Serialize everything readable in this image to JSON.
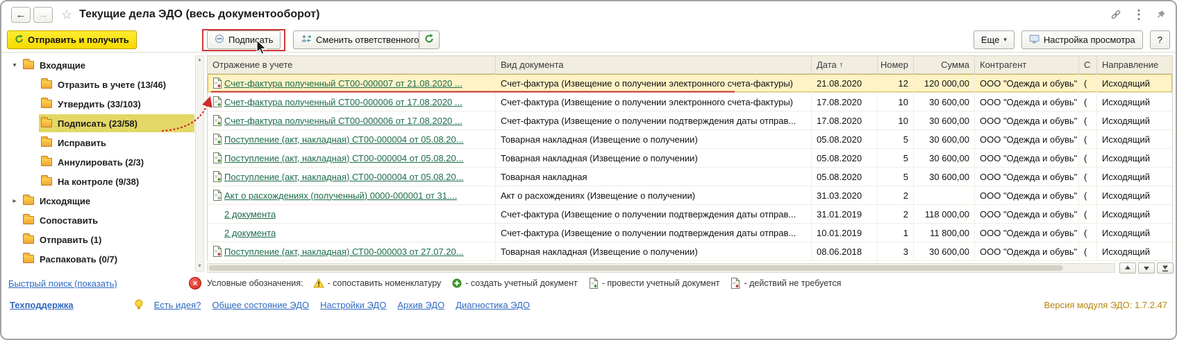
{
  "window": {
    "title": "Текущие дела ЭДО (весь документооборот)"
  },
  "toolbar": {
    "send_receive": "Отправить и получить",
    "sign": "Подписать",
    "change_responsible": "Сменить ответственного",
    "more": "Еще",
    "view_settings": "Настройка просмотра",
    "help": "?"
  },
  "sidebar": {
    "items": [
      {
        "label": "Входящие",
        "level": 0,
        "expander": "open"
      },
      {
        "label": "Отразить в учете (13/46)",
        "level": 1
      },
      {
        "label": "Утвердить (33/103)",
        "level": 1
      },
      {
        "label": "Подписать (23/58)",
        "level": 1,
        "selected": true
      },
      {
        "label": "Исправить",
        "level": 1
      },
      {
        "label": "Аннулировать (2/3)",
        "level": 1
      },
      {
        "label": "На контроле (9/38)",
        "level": 1
      },
      {
        "label": "Исходящие",
        "level": 0,
        "expander": "closed"
      },
      {
        "label": "Сопоставить",
        "level": 0
      },
      {
        "label": "Отправить (1)",
        "level": 0
      },
      {
        "label": "Распаковать (0/7)",
        "level": 0
      }
    ],
    "quick_search": "Быстрый поиск (показать)"
  },
  "table": {
    "columns": [
      {
        "label": "Отражение в учете"
      },
      {
        "label": "Вид документа"
      },
      {
        "label": "Дата",
        "sort": "asc"
      },
      {
        "label": "Номер"
      },
      {
        "label": "Сумма"
      },
      {
        "label": "Контрагент"
      },
      {
        "label": "С"
      },
      {
        "label": "Направление"
      }
    ],
    "rows": [
      {
        "icon": "doc-red",
        "selected": true,
        "doc": "Счет-фактура полученный СТ00-000007 от 21.08.2020 ...",
        "type": "Счет-фактура (Извещение о получении электронного счета-фактуры)",
        "date": "21.08.2020",
        "num": "12",
        "sum": "120 000,00",
        "contragent": "ООО \"Одежда и обувь\"",
        "state": "(",
        "direction": "Исходящий"
      },
      {
        "icon": "doc-green",
        "doc": "Счет-фактура полученный СТ00-000006 от 17.08.2020 ...",
        "type": "Счет-фактура (Извещение о получении электронного счета-фактуры)",
        "date": "17.08.2020",
        "num": "10",
        "sum": "30 600,00",
        "contragent": "ООО \"Одежда и обувь\"",
        "state": "(",
        "direction": "Исходящий"
      },
      {
        "icon": "doc-green",
        "doc": "Счет-фактура полученный СТ00-000006 от 17.08.2020 ...",
        "type": "Счет-фактура (Извещение о получении подтверждения даты отправ...",
        "date": "17.08.2020",
        "num": "10",
        "sum": "30 600,00",
        "contragent": "ООО \"Одежда и обувь\"",
        "state": "(",
        "direction": "Исходящий"
      },
      {
        "icon": "doc-green",
        "doc": "Поступление (акт, накладная) СТ00-000004 от 05.08.20...",
        "type": "Товарная накладная (Извещение о получении)",
        "date": "05.08.2020",
        "num": "5",
        "sum": "30 600,00",
        "contragent": "ООО \"Одежда и обувь\"",
        "state": "(",
        "direction": "Исходящий"
      },
      {
        "icon": "doc-green",
        "doc": "Поступление (акт, накладная) СТ00-000004 от 05.08.20...",
        "type": "Товарная накладная (Извещение о получении)",
        "date": "05.08.2020",
        "num": "5",
        "sum": "30 600,00",
        "contragent": "ООО \"Одежда и обувь\"",
        "state": "(",
        "direction": "Исходящий"
      },
      {
        "icon": "doc-green",
        "doc": "Поступление (акт, накладная) СТ00-000004 от 05.08.20...",
        "type": "Товарная накладная",
        "date": "05.08.2020",
        "num": "5",
        "sum": "30 600,00",
        "contragent": "ООО \"Одежда и обувь\"",
        "state": "(",
        "direction": "Исходящий"
      },
      {
        "icon": "doc-gray",
        "doc": "Акт о расхождениях (полученный) 0000-000001 от 31....",
        "type": "Акт о расхождениях (Извещение о получении)",
        "date": "31.03.2020",
        "num": "2",
        "sum": "",
        "contragent": "ООО \"Одежда и обувь\"",
        "state": "(",
        "direction": "Исходящий"
      },
      {
        "icon": "none",
        "doc": "2 документа",
        "type": "Счет-фактура (Извещение о получении подтверждения даты отправ...",
        "date": "31.01.2019",
        "num": "2",
        "sum": "118 000,00",
        "contragent": "ООО \"Одежда и обувь\"",
        "state": "(",
        "direction": "Исходящий"
      },
      {
        "icon": "none",
        "doc": "2 документа",
        "type": "Счет-фактура (Извещение о получении подтверждения даты отправ...",
        "date": "10.01.2019",
        "num": "1",
        "sum": "11 800,00",
        "contragent": "ООО \"Одежда и обувь\"",
        "state": "(",
        "direction": "Исходящий"
      },
      {
        "icon": "doc-red",
        "doc": "Поступление (акт, накладная) СТ00-000003 от 27.07.20...",
        "type": "Товарная накладная (Извещение о получении)",
        "date": "08.06.2018",
        "num": "3",
        "sum": "30 600,00",
        "contragent": "ООО \"Одежда и обувь\"",
        "state": "(",
        "direction": "Исходящий"
      }
    ]
  },
  "legend": {
    "title": "Условные обозначения:",
    "items": [
      {
        "icon": "warning-triangle",
        "label": "- сопоставить номенклатуру"
      },
      {
        "icon": "plus-circle",
        "label": "- создать учетный документ"
      },
      {
        "icon": "doc-green",
        "label": "- провести учетный документ"
      },
      {
        "icon": "doc-red",
        "label": "- действий не требуется"
      }
    ]
  },
  "footer": {
    "support": "Техподдержка",
    "idea": "Есть идея?",
    "links": [
      "Общее состояние ЭДО",
      "Настройки ЭДО",
      "Архив ЭДО",
      "Диагностика ЭДО"
    ],
    "version": "Версия модуля ЭДО: 1.7.2.47"
  },
  "colors": {
    "accent_yellow": "#F8D900",
    "row_selection": "#FFF3C6",
    "sidebar_selection": "#E3D765",
    "table_link_green": "#1C6B4A",
    "link_blue": "#2E68C2",
    "annotation_red": "#C7342C",
    "version_orange": "#B8860B"
  }
}
